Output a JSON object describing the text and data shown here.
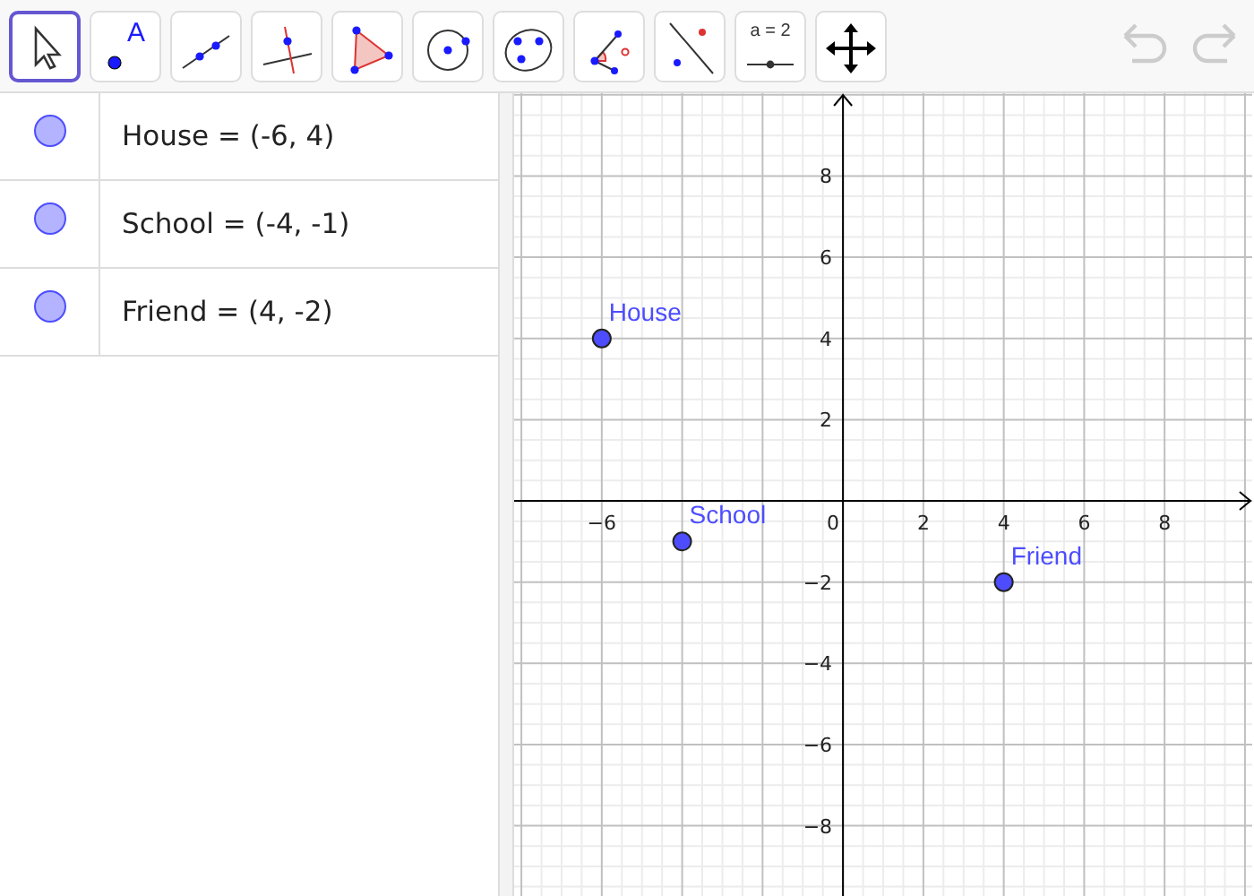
{
  "toolbar": {
    "tools": [
      {
        "kind": "move",
        "selected": true
      },
      {
        "kind": "point",
        "selected": false,
        "label": "A"
      },
      {
        "kind": "line",
        "selected": false
      },
      {
        "kind": "perpendicular",
        "selected": false
      },
      {
        "kind": "polygon",
        "selected": false
      },
      {
        "kind": "circle",
        "selected": false
      },
      {
        "kind": "conic",
        "selected": false
      },
      {
        "kind": "angle",
        "selected": false
      },
      {
        "kind": "reflect",
        "selected": false
      },
      {
        "kind": "slider",
        "selected": false,
        "label": "a = 2"
      },
      {
        "kind": "pan",
        "selected": false
      }
    ],
    "history": [
      {
        "kind": "undo",
        "disabled": true
      },
      {
        "kind": "redo",
        "disabled": true
      }
    ]
  },
  "algebra": {
    "items": [
      {
        "text": "House = (-6, 4)",
        "visible": true
      },
      {
        "text": "School = (-4, -1)",
        "visible": true
      },
      {
        "text": "Friend = (4, -2)",
        "visible": true
      }
    ]
  },
  "graphics": {
    "chart_data": {
      "type": "scatter",
      "x": [
        -6,
        -4,
        4
      ],
      "series": [
        {
          "color": "#4d4dff",
          "values": [
            4,
            -1,
            -2
          ]
        }
      ],
      "value_labels": [
        "House",
        "School",
        "Friend"
      ],
      "xlim": [
        -8.18,
        10.18
      ],
      "ylim": [
        -9.73,
        10.04
      ],
      "grid": true,
      "xticks": [
        {
          "value": -6,
          "label": "−6"
        },
        {
          "value": 0,
          "label": "0"
        },
        {
          "value": 2,
          "label": "2"
        },
        {
          "value": 4,
          "label": "4"
        },
        {
          "value": 6,
          "label": "6"
        },
        {
          "value": 8,
          "label": "8"
        }
      ],
      "yticks": [
        {
          "value": -8,
          "label": "−8"
        },
        {
          "value": -6,
          "label": "−6"
        },
        {
          "value": -4,
          "label": "−4"
        },
        {
          "value": -2,
          "label": "−2"
        },
        {
          "value": 2,
          "label": "2"
        },
        {
          "value": 4,
          "label": "4"
        },
        {
          "value": 6,
          "label": "6"
        },
        {
          "value": 8,
          "label": "8"
        }
      ]
    }
  }
}
